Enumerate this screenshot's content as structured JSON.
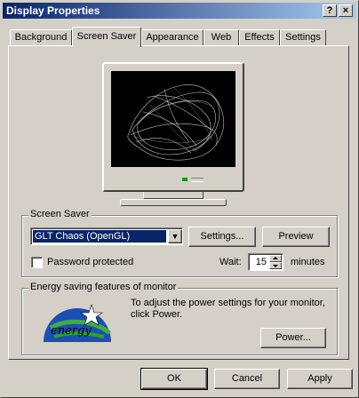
{
  "window": {
    "title": "Display Properties",
    "help_glyph": "?",
    "close_glyph": "×"
  },
  "tabs": [
    {
      "label": "Background"
    },
    {
      "label": "Screen Saver"
    },
    {
      "label": "Appearance"
    },
    {
      "label": "Web"
    },
    {
      "label": "Effects"
    },
    {
      "label": "Settings"
    }
  ],
  "active_tab": "Screen Saver",
  "screensaver": {
    "group_label": "Screen Saver",
    "selected": "GLT Chaos (OpenGL)",
    "dropdown_glyph": "▼",
    "settings_label": "Settings...",
    "preview_label": "Preview",
    "password_label": "Password protected",
    "password_checked": false,
    "wait_label": "Wait:",
    "wait_value": "15",
    "minutes_label": "minutes"
  },
  "energy": {
    "group_label": "Energy saving features of monitor",
    "description": "To adjust the power settings for your monitor, click Power.",
    "power_label": "Power...",
    "logo_text": "energy"
  },
  "footer": {
    "ok_label": "OK",
    "cancel_label": "Cancel",
    "apply_label": "Apply"
  },
  "colors": {
    "titlebar_start": "#0a246a",
    "selection": "#0a246a",
    "face": "#d4d0c8"
  }
}
